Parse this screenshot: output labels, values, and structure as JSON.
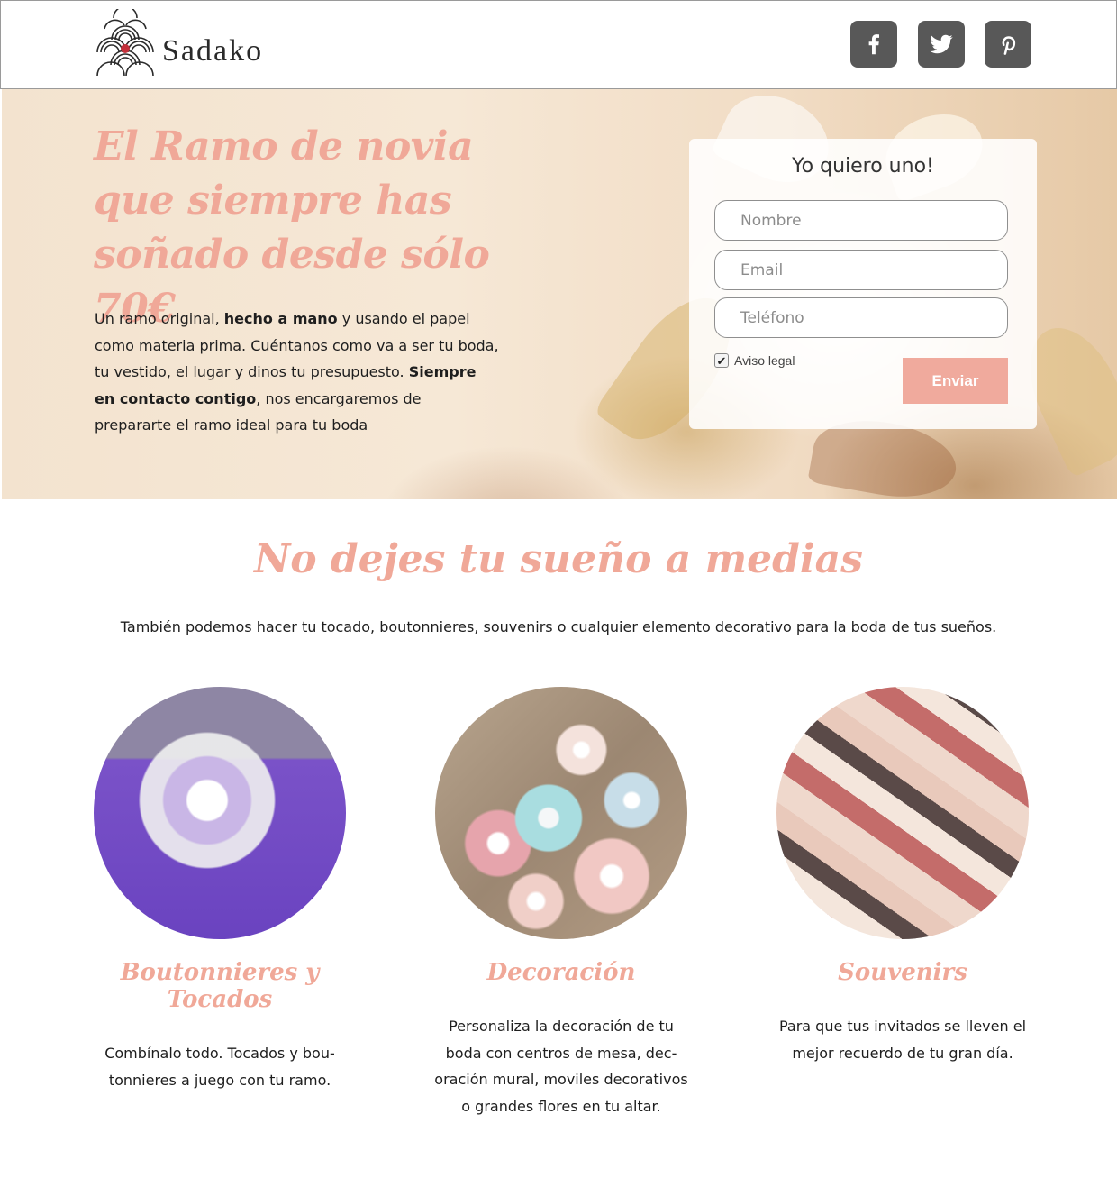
{
  "brand": {
    "name": "Sadako",
    "logo_icon": "wave-fan-logo"
  },
  "social": [
    {
      "name": "facebook",
      "icon": "facebook-icon"
    },
    {
      "name": "twitter",
      "icon": "twitter-icon"
    },
    {
      "name": "pinterest",
      "icon": "pinterest-icon"
    }
  ],
  "hero": {
    "title": "El Ramo de novia que siempre has soñado desde sólo 70€",
    "text_parts": [
      "Un ramo original, ",
      "hecho a mano",
      " y usando el papel como materia prima. Cuéntanos como va a ser tu boda, tu vestido, el lugar y dinos tu presupuesto. ",
      "Siempre en contacto contigo",
      ", nos encargaremos de prepararte el ramo ideal para tu boda"
    ]
  },
  "form": {
    "title": "Yo quiero uno!",
    "name_placeholder": "Nombre",
    "email_placeholder": "Email",
    "phone_placeholder": "Teléfono",
    "legal_label": "Aviso legal",
    "legal_checked": true,
    "submit_label": "Enviar"
  },
  "section": {
    "title": "No dejes tu sueño a medias",
    "subtitle": "También podemos hacer tu tocado, boutonnieres, souvenirs o cualquier elemento decorativo para la boda de tus sueños."
  },
  "cards": [
    {
      "title": "Boutonnieres y Tocados",
      "text": "Combínalo todo. Tocados y bou- tonnieres a juego con tu ramo."
    },
    {
      "title": "Decoración",
      "text": "Personaliza la decoración de tu boda con centros de mesa, dec- oración mural, moviles decorativos o grandes flores en tu altar."
    },
    {
      "title": "Souvenirs",
      "text": "Para que tus invitados se lleven el mejor recuerdo de tu gran día."
    }
  ],
  "colors": {
    "accent": "#f0a898",
    "button": "#f0aa9d",
    "social_bg": "#585858"
  }
}
